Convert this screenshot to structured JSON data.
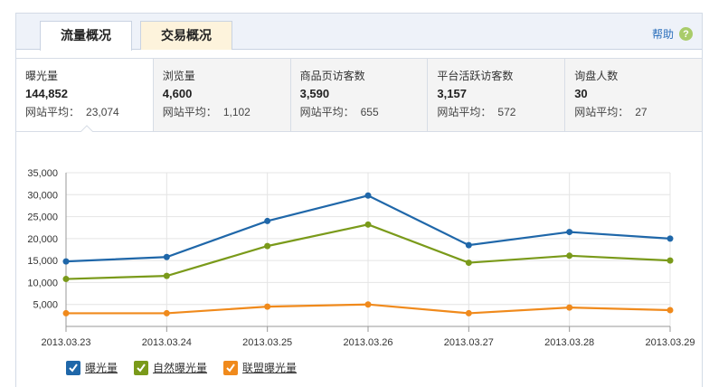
{
  "tabs": [
    {
      "label": "流量概况",
      "active": true
    },
    {
      "label": "交易概况",
      "active": false
    }
  ],
  "help": {
    "label": "帮助",
    "icon": "help-icon",
    "icon_glyph": "?"
  },
  "stats": [
    {
      "title": "曝光量",
      "value": "144,852",
      "avg_label": "网站平均：",
      "avg_value": "23,074",
      "selected": true
    },
    {
      "title": "浏览量",
      "value": "4,600",
      "avg_label": "网站平均：",
      "avg_value": "1,102",
      "selected": false
    },
    {
      "title": "商品页访客数",
      "value": "3,590",
      "avg_label": "网站平均：",
      "avg_value": "655",
      "selected": false
    },
    {
      "title": "平台活跃访客数",
      "value": "3,157",
      "avg_label": "网站平均：",
      "avg_value": "572",
      "selected": false
    },
    {
      "title": "询盘人数",
      "value": "30",
      "avg_label": "网站平均：",
      "avg_value": "27",
      "selected": false
    }
  ],
  "chart_data": {
    "type": "line",
    "x": [
      "2013.03.23",
      "2013.03.24",
      "2013.03.25",
      "2013.03.26",
      "2013.03.27",
      "2013.03.28",
      "2013.03.29"
    ],
    "ylim": [
      0,
      35000
    ],
    "yticks": [
      5000,
      10000,
      15000,
      20000,
      25000,
      30000,
      35000
    ],
    "ytick_labels": [
      "5,000",
      "10,000",
      "15,000",
      "20,000",
      "25,000",
      "30,000",
      "35,000"
    ],
    "grid": true,
    "series": [
      {
        "name": "曝光量",
        "color": "#1f67a9",
        "values": [
          14800,
          15800,
          24000,
          29800,
          18500,
          21500,
          20000
        ]
      },
      {
        "name": "自然曝光量",
        "color": "#7a9a1a",
        "values": [
          10800,
          11500,
          18300,
          23200,
          14500,
          16100,
          15000
        ]
      },
      {
        "name": "联盟曝光量",
        "color": "#f08a1c",
        "values": [
          3000,
          3000,
          4500,
          5000,
          3000,
          4300,
          3700
        ]
      }
    ],
    "legend_position": "bottom-left"
  }
}
